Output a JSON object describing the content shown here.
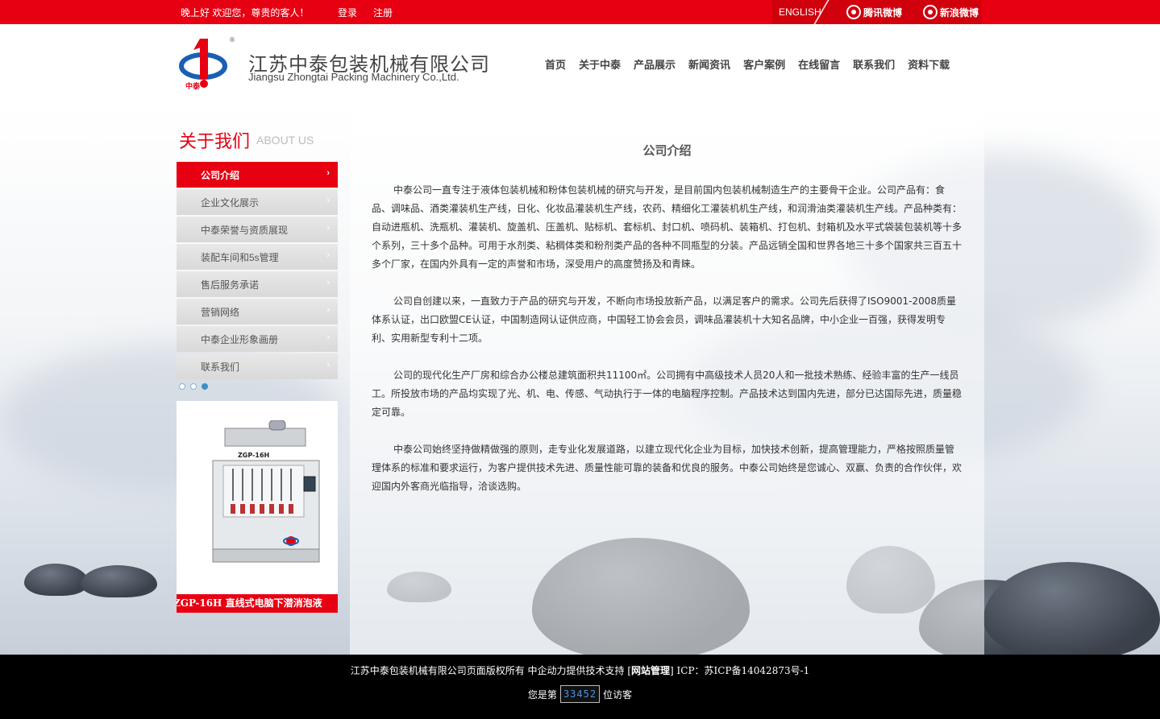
{
  "topbar": {
    "greeting": "晚上好  欢迎您，尊贵的客人！",
    "login": "登录",
    "register": "注册",
    "english": "ENGLISH",
    "tencent_weibo": "腾讯微博",
    "sina_weibo": "新浪微博"
  },
  "header": {
    "logo_text": "中泰",
    "company_cn": "江苏中泰包装机械有限公司",
    "company_en": "Jiangsu Zhongtai Packing Machinery Co.,Ltd.",
    "nav": [
      "首页",
      "关于中泰",
      "产品展示",
      "新闻资讯",
      "客户案例",
      "在线留言",
      "联系我们",
      "资料下载"
    ]
  },
  "sidebar": {
    "title": "关于我们",
    "title_en": "ABOUT US",
    "items": [
      "公司介绍",
      "企业文化展示",
      "中泰荣誉与资质展现",
      "装配车间和5s管理",
      "售后服务承诺",
      "营销网络",
      "中泰企业形象画册",
      "联系我们"
    ],
    "active_index": 0,
    "product_label": "ZGP-16H",
    "product_caption": "ZGP-16H  直线式电脑下潜消泡液"
  },
  "main": {
    "title": "公司介绍",
    "paragraphs": [
      "中泰公司一直专注于液体包装机械和粉体包装机械的研究与开发，是目前国内包装机械制造生产的主要骨干企业。公司产品有：食品、调味品、酒类灌装机生产线，日化、化妆品灌装机生产线，农药、精细化工灌装机机生产线，和润滑油类灌装机生产线。产品种类有：自动进瓶机、洗瓶机、灌装机、旋盖机、压盖机、贴标机、套标机、封口机、喷码机、装箱机、打包机、封箱机及水平式袋装包装机等十多个系列，三十多个品种。可用于水剂类、粘稠体类和粉剂类产品的各种不同瓶型的分装。产品远销全国和世界各地三十多个国家共三百五十多个厂家，在国内外具有一定的声誉和市场，深受用户的高度赞扬及和青睐。",
      "公司自创建以来，一直致力于产品的研究与开发，不断向市场投放新产品，以满足客户的需求。公司先后获得了ISO9001-2008质量体系认证，出口欧盟CE认证，中国制造网认证供应商，中国轻工协会会员，调味品灌装机十大知名品牌，中小企业一百强，获得发明专利、实用新型专利十二项。",
      "公司的现代化生产厂房和综合办公楼总建筑面积共11100㎡。公司拥有中高级技术人员20人和一批技术熟练、经验丰富的生产一线员工。所投放市场的产品均实现了光、机、电、传感、气动执行于一体的电脑程序控制。产品技术达到国内先进，部分已达国际先进，质量稳定可靠。",
      "中泰公司始终坚持做精做强的原则，走专业化发展道路，以建立现代化企业为目标，加快技术创新，提高管理能力，严格按照质量管理体系的标准和要求运行，为客户提供技术先进、质量性能可靠的装备和优良的服务。中泰公司始终是您诚心、双赢、负责的合作伙伴，欢迎国内外客商光临指导，洽谈选购。"
    ]
  },
  "footer": {
    "copyright_prefix": "江苏中泰包装机械有限公司页面版权所有 中企动力提供技术支持 [",
    "admin_link": "网站管理",
    "copyright_suffix": "] ICP：苏ICP备14042873号-1",
    "visitor_prefix": "您是第",
    "visitor_count": "33452",
    "visitor_suffix": "位访客"
  },
  "colors": {
    "brand_red": "#e60012",
    "footer_bg": "#000000",
    "counter_blue": "#4a90e2"
  }
}
